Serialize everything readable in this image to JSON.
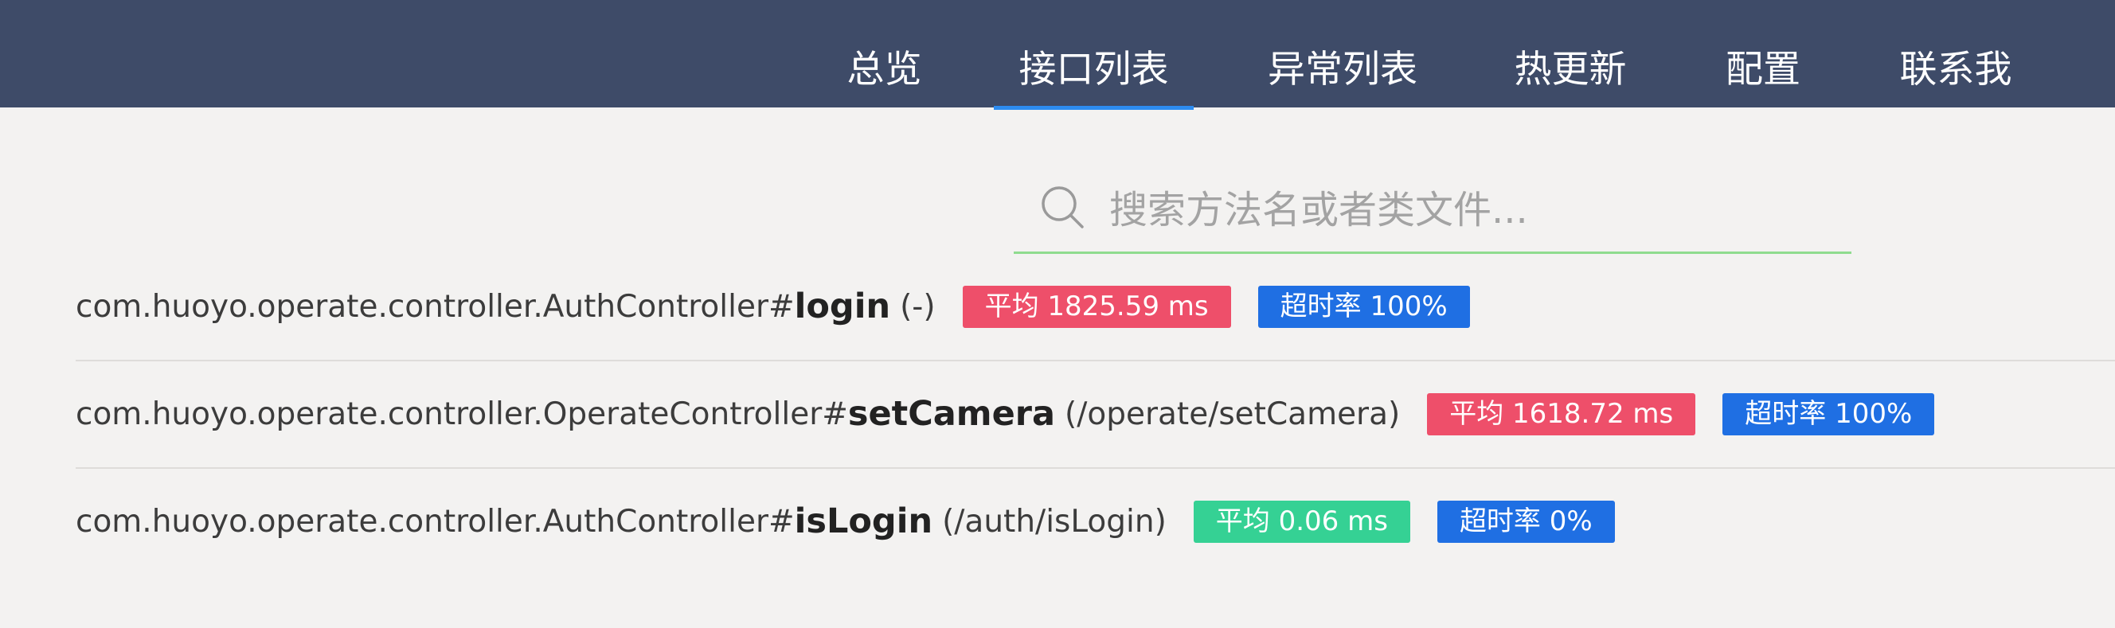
{
  "nav": {
    "items": [
      {
        "label": "总览"
      },
      {
        "label": "接口列表",
        "active": true
      },
      {
        "label": "异常列表"
      },
      {
        "label": "热更新"
      },
      {
        "label": "配置"
      },
      {
        "label": "联系我"
      }
    ]
  },
  "search": {
    "placeholder": "搜索方法名或者类文件...",
    "value": "",
    "icon": "search-icon"
  },
  "colors": {
    "navbar": "#3e4b68",
    "active_underline": "#2d8cf0",
    "search_underline": "#8fdc8f",
    "badge_slow": "#ee4f6a",
    "badge_ok": "#35d194",
    "badge_timeout": "#1f6fe3"
  },
  "rows": [
    {
      "package": "com.huoyo.operate.controller.AuthController#",
      "method": "login",
      "path": "(-)",
      "avg": "平均 1825.59 ms",
      "avg_status": "slow",
      "timeout": "超时率 100%"
    },
    {
      "package": "com.huoyo.operate.controller.OperateController#",
      "method": "setCamera",
      "path": "(/operate/setCamera)",
      "avg": "平均 1618.72 ms",
      "avg_status": "slow",
      "timeout": "超时率 100%"
    },
    {
      "package": "com.huoyo.operate.controller.AuthController#",
      "method": "isLogin",
      "path": "(/auth/isLogin)",
      "avg": "平均 0.06 ms",
      "avg_status": "ok",
      "timeout": "超时率 0%"
    }
  ]
}
